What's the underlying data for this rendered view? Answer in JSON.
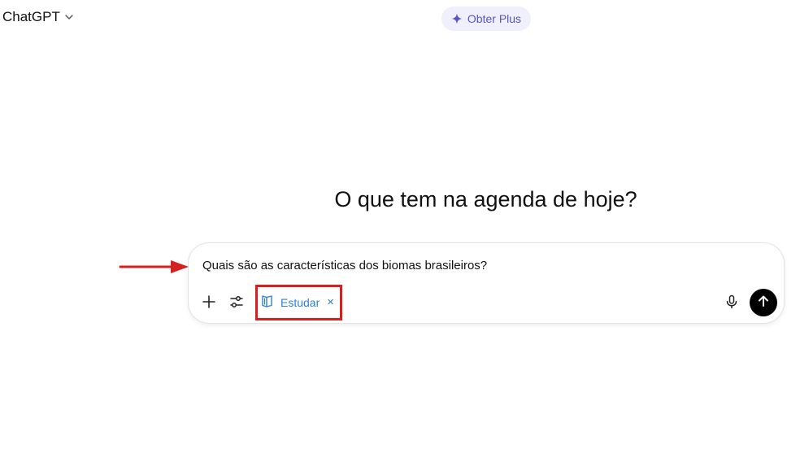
{
  "header": {
    "model_name": "ChatGPT",
    "model_icon": "chevron-down-icon",
    "upgrade_label": "Obter Plus",
    "upgrade_icon": "sparkle-icon"
  },
  "main": {
    "heading": "O que tem na agenda de hoje?"
  },
  "composer": {
    "prompt_text": "Quais são as características dos biomas brasileiros?",
    "tools": [
      {
        "name": "add",
        "icon": "plus-icon"
      },
      {
        "name": "tools",
        "icon": "sliders-icon"
      }
    ],
    "active_mode": {
      "label": "Estudar",
      "icon": "book-icon",
      "close_glyph": "×"
    },
    "mic_icon": "microphone-icon",
    "send_icon": "arrow-up-icon"
  },
  "colors": {
    "upgrade_bg": "#f0effc",
    "upgrade_text": "#5b54c9",
    "mode_chip": "#2b7fd8",
    "annotation": "#d42020",
    "send_bg": "#000000"
  }
}
